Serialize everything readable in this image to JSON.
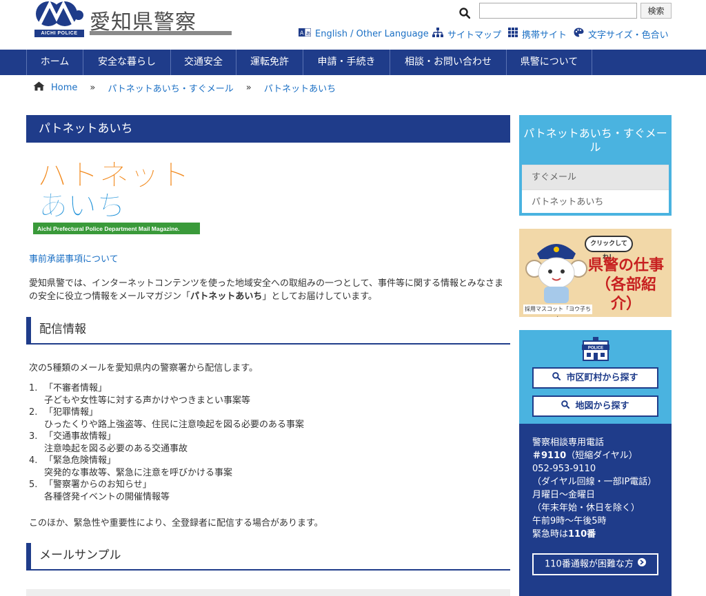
{
  "header": {
    "logo_title": "愛知県警察",
    "logo_sub": "AICHI POLICE",
    "search": {
      "placeholder": "",
      "button_label": "検索"
    },
    "utility_links": [
      {
        "label": "English / Other Language",
        "icon": "translate-icon"
      },
      {
        "label": "サイトマップ",
        "icon": "sitemap-icon"
      },
      {
        "label": "携帯サイト",
        "icon": "grid-icon"
      },
      {
        "label": "文字サイズ・色合い",
        "icon": "palette-icon"
      }
    ]
  },
  "nav": {
    "items": [
      "ホーム",
      "安全な暮らし",
      "交通安全",
      "運転免許",
      "申請・手続き",
      "相談・お問い合わせ",
      "県警について"
    ]
  },
  "breadcrumb": {
    "home": "Home",
    "items": [
      "パトネットあいち・すぐメール",
      "パトネットあいち"
    ],
    "separator": "»"
  },
  "main": {
    "page_title": "パトネットあいち",
    "banner": {
      "line1": "パトネット",
      "line2": "あいち",
      "caption": "Aichi Prefectural Police Department Mail Magazine."
    },
    "prior_consent_link": "事前承諾事項について",
    "intro_pre": "愛知県警では、インターネットコンテンツを使った地域安全への取組みの一つとして、事件等に関する情報とみなさまの安全に役立つ情報をメールマガジン「",
    "intro_bold": "パトネットあいち",
    "intro_post": "」としてお届けしています。",
    "section_delivery": "配信情報",
    "delivery_lead": "次の5種類のメールを愛知県内の警察署から配信します。",
    "delivery_items": [
      {
        "num": "1.",
        "title": "「不審者情報」",
        "desc": "子どもや女性等に対する声かけやつきまとい事案等"
      },
      {
        "num": "2.",
        "title": "「犯罪情報」",
        "desc": "ひったくりや路上強盗等、住民に注意喚起を図る必要のある事案"
      },
      {
        "num": "3.",
        "title": "「交通事故情報」",
        "desc": "注意喚起を図る必要のある交通事故"
      },
      {
        "num": "4.",
        "title": "「緊急危険情報」",
        "desc": "突発的な事故等、緊急に注意を呼びかける事案"
      },
      {
        "num": "5.",
        "title": "「警察署からのお知らせ」",
        "desc": "各種啓発イベントの開催情報等"
      }
    ],
    "delivery_note": "このほか、緊急性や重要性により、全登録者に配信する場合があります。",
    "section_sample": "メールサンプル"
  },
  "sidebar": {
    "menu_title": "パトネットあいち・すぐメール",
    "menu_items": [
      "すぐメール",
      "パトネットあいち"
    ],
    "job_banner": {
      "bubble": "クリックしてね！",
      "title_line1": "県警の仕事",
      "title_line2": "（各部紹介）",
      "caption": "採用マスコット「ヨウ子ちゃん」"
    },
    "station": {
      "icon_label": "POLICE",
      "btn_city": "市区町村から探す",
      "btn_map": "地図から探す"
    },
    "consult": {
      "line1": "警察相談専用電話",
      "line2_bold": "＃9110",
      "line2_rest": "（短縮ダイヤル）",
      "line3": "052-953-9110",
      "line4": "（ダイヤル回線・一部IP電話）",
      "line5": "月曜日～金曜日",
      "line6": "（年末年始・休日を除く）",
      "line7": "午前9時～午後5時",
      "line8_pre": "緊急時は",
      "line8_bold": "110番",
      "button": "110番通報が困難な方"
    }
  },
  "colors": {
    "navy": "#1f3c8a",
    "sky": "#4ab3e0",
    "link": "#1a6fc4"
  }
}
